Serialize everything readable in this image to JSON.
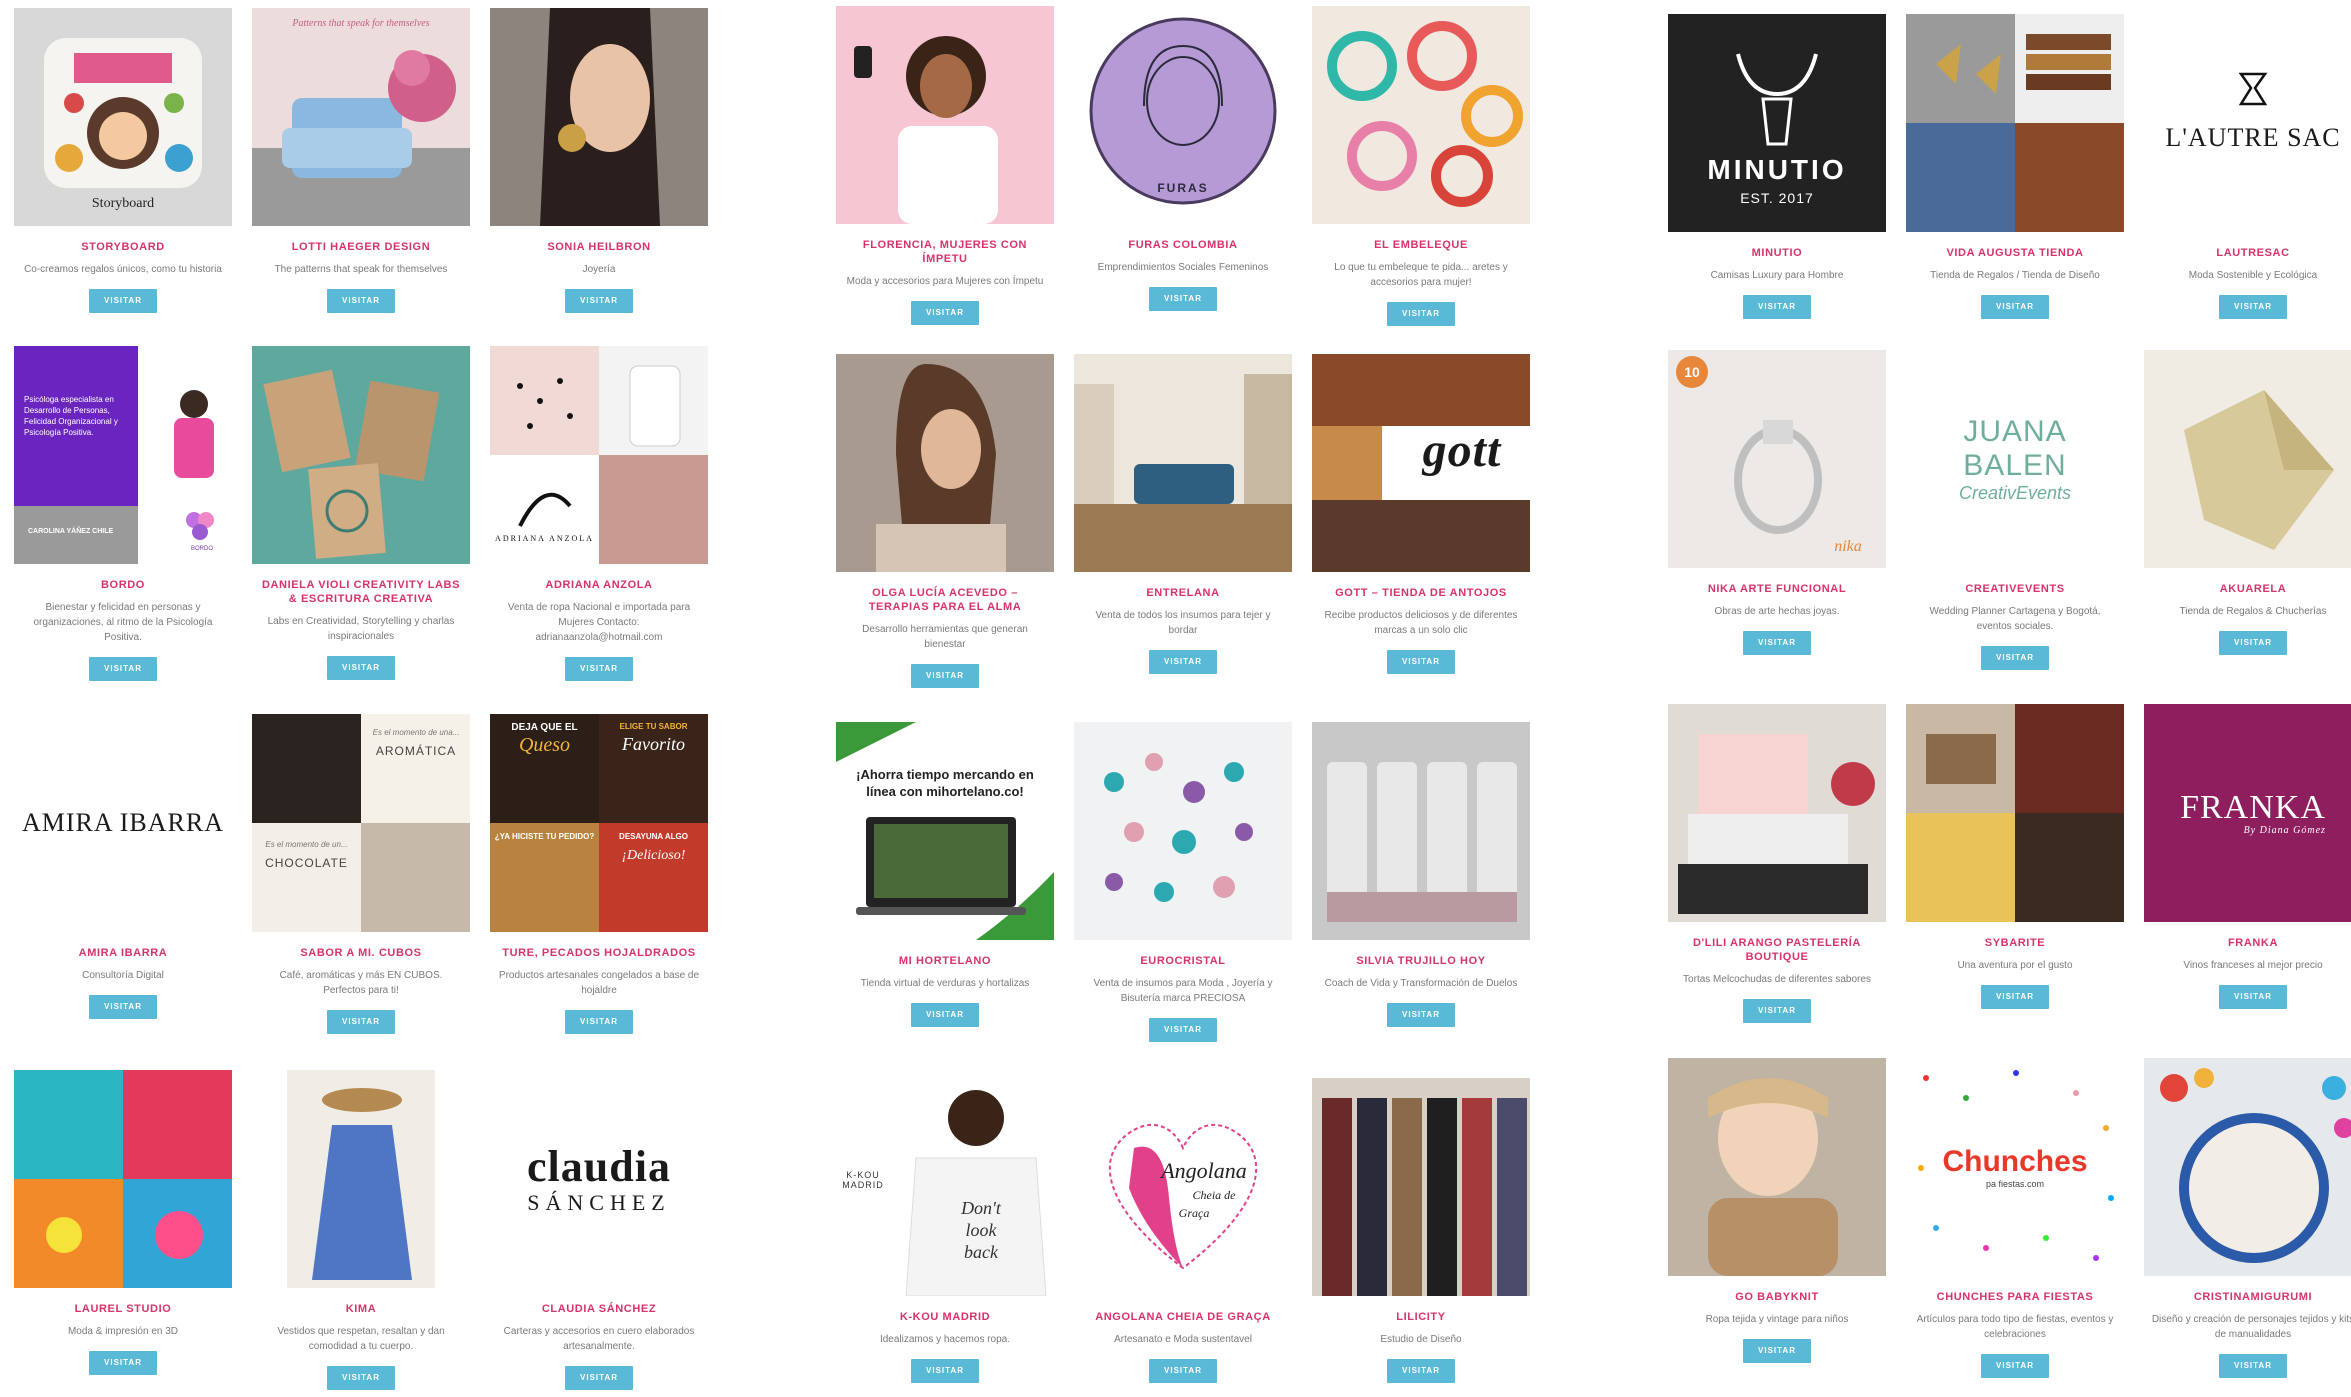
{
  "visit_label": "VISITAR",
  "colors": {
    "title": "#d6336c",
    "button": "#5ab9d6",
    "desc": "#7a7a7a"
  },
  "panels": [
    {
      "cards": [
        {
          "title": "STORYBOARD",
          "desc": "Co-creamos regalos únicos, como tu historia"
        },
        {
          "title": "LOTTI HAEGER DESIGN",
          "desc": "The patterns that speak for themselves"
        },
        {
          "title": "SONIA HEILBRON",
          "desc": "Joyería"
        },
        {
          "title": "BORDO",
          "desc": "Bienestar y felicidad en personas y organizaciones, al ritmo de la Psicología Positiva."
        },
        {
          "title": "DANIELA VIOLI CREATIVITY LABS & ESCRITURA CREATIVA",
          "desc": "Labs en Creatividad, Storytelling y charlas inspiracionales"
        },
        {
          "title": "ADRIANA ANZOLA",
          "desc": "Venta de ropa Nacional e importada para Mujeres Contacto: adrianaanzola@hotmail.com"
        },
        {
          "title": "AMIRA IBARRA",
          "desc": "Consultoría Digital"
        },
        {
          "title": "SABOR A MI. CUBOS",
          "desc": "Café, aromáticas y más EN CUBOS. Perfectos para ti!"
        },
        {
          "title": "TURE, PECADOS HOJALDRADOS",
          "desc": "Productos artesanales congelados a base de hojaldre"
        },
        {
          "title": "LAUREL STUDIO",
          "desc": "Moda & impresión en 3D"
        },
        {
          "title": "KIMA",
          "desc": "Vestidos que respetan, resaltan y dan comodidad a tu cuerpo."
        },
        {
          "title": "CLAUDIA SÁNCHEZ",
          "desc": "Carteras y accesorios en cuero elaborados artesanalmente."
        }
      ]
    },
    {
      "cards": [
        {
          "title": "FLORENCIA, MUJERES CON ÍMPETU",
          "desc": "Moda y accesorios para Mujeres con Ímpetu"
        },
        {
          "title": "FURAS COLOMBIA",
          "desc": "Emprendimientos Sociales Femeninos"
        },
        {
          "title": "EL EMBELEQUE",
          "desc": "Lo que tu embeleque te pida... aretes y accesorios para mujer!"
        },
        {
          "title": "OLGA LUCÍA ACEVEDO – TERAPIAS PARA EL ALMA",
          "desc": "Desarrollo herramientas que generan bienestar"
        },
        {
          "title": "ENTRELANA",
          "desc": "Venta de todos los insumos para tejer y bordar"
        },
        {
          "title": "GOTT – TIENDA DE ANTOJOS",
          "desc": "Recibe productos deliciosos y de diferentes marcas a un solo clic"
        },
        {
          "title": "MI HORTELANO",
          "desc": "Tienda virtual de verduras y hortalizas"
        },
        {
          "title": "EUROCRISTAL",
          "desc": "Venta de insumos para Moda , Joyería y Bisutería marca PRECIOSA"
        },
        {
          "title": "SILVIA TRUJILLO HOY",
          "desc": "Coach de Vida y Transformación de Duelos"
        },
        {
          "title": "K-KOU MADRID",
          "desc": "Idealizamos y hacemos ropa."
        },
        {
          "title": "ANGOLANA CHEIA DE GRAÇA",
          "desc": "Artesanato e Moda sustentavel"
        },
        {
          "title": "LILICITY",
          "desc": "Estudio de Diseño"
        }
      ]
    },
    {
      "cards": [
        {
          "title": "MINUTIO",
          "desc": "Camisas Luxury para Hombre"
        },
        {
          "title": "VIDA AUGUSTA TIENDA",
          "desc": "Tienda de Regalos / Tienda de Diseño"
        },
        {
          "title": "LAUTRESAC",
          "desc": "Moda Sostenible y Ecológica"
        },
        {
          "title": "NIKA ARTE FUNCIONAL",
          "desc": "Obras de arte hechas joyas."
        },
        {
          "title": "CREATIVEVENTS",
          "desc": "Wedding Planner Cartagena y Bogotá, eventos sociales."
        },
        {
          "title": "AKUARELA",
          "desc": "Tienda de Regalos & Chucherías"
        },
        {
          "title": "D'LILI ARANGO PASTELERÍA BOUTIQUE",
          "desc": "Tortas Melcochudas de diferentes sabores"
        },
        {
          "title": "SYBARITE",
          "desc": "Una aventura por el gusto"
        },
        {
          "title": "FRANKA",
          "desc": "Vinos franceses al mejor precio"
        },
        {
          "title": "GO BABYKNIT",
          "desc": "Ropa tejida y vintage para niños"
        },
        {
          "title": "CHUNCHES PARA FIESTAS",
          "desc": "Artículos para todo tipo de fiestas, eventos y celebraciones"
        },
        {
          "title": "CRISTINAMIGURUMI",
          "desc": "Diseño y creación de personajes tejidos y kits de manualidades"
        }
      ]
    }
  ],
  "logos": {
    "amira": "AMIRA IBARRA",
    "claudia_1": "claudia",
    "claudia_2": "SÁNCHEZ",
    "minutio_1": "MINUTIO",
    "minutio_2": "EST. 2017",
    "lautresac": "L'AUTRE SAC",
    "juana_1": "JUANA",
    "juana_2": "BALEN",
    "juana_3": "CreativEvents",
    "franka_1": "FRANKA",
    "franka_2": "By Diana Gómez",
    "gott": "gott",
    "storyboard": "Storyboard",
    "lotti": "Patterns that speak for themselves",
    "furas": "FURAS",
    "hortelano": "¡Ahorra tiempo mercando en línea con mihortelano.co!",
    "queso_1": "DEJA QUE EL",
    "queso_2": "Queso",
    "queso_3": "ELIGE TU SABOR",
    "queso_4": "Favorito",
    "queso_5": "¿YA HICISTE TU PEDIDO?",
    "queso_6": "DESAYUNA ALGO",
    "queso_7": "¡Delicioso!",
    "aromatica_1": "Es el momento de una...",
    "aromatica_2": "AROMÁTICA",
    "choco_1": "Es el momento de un...",
    "choco_2": "CHOCOLATE",
    "bordo_text": "Psicóloga especialista en Desarrollo de Personas, Felicidad Organizacional y Psicología Positiva.",
    "bordo_name": "CAROLINA YÁÑEZ CHILE",
    "bordo_logo": "BORDO",
    "adriana": "ADRIANA ANZOLA",
    "kkou_brand": "K-KOU MADRID",
    "kkou_1": "Don't",
    "kkou_2": "look",
    "kkou_3": "back",
    "angolana_1": "Angolana",
    "angolana_2": "Cheia de",
    "angolana_3": "Graça",
    "chunches_1": "Chunches",
    "chunches_2": "pa fiestas.com",
    "nika_badge": "10",
    "nika_brand": "nika"
  }
}
